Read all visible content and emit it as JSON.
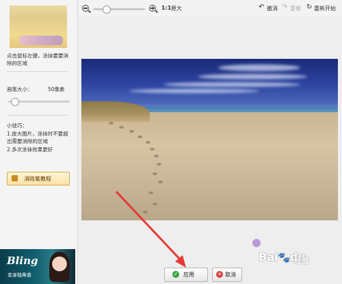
{
  "sidebar": {
    "instruction": "点击鼠标左键，涂抹要要消除的区域",
    "brush_size_label": "画笔大小：",
    "brush_size_value": "50像素",
    "brush_size_level": 0.1,
    "tips_title": "小技巧：",
    "tip_1": "1.放大图片，涂抹时不要超出需要消除的区域",
    "tip_2": "2.多次涂抹效果更好",
    "tutorial_button": "消除笔教程"
  },
  "ad": {
    "brand": "Bling",
    "caption": "变身独角兽"
  },
  "toolbar": {
    "zoom_level": 0.25,
    "original_size_label": "1:1",
    "original_size_text": "原大",
    "undo_label": "撤消",
    "redo_label": "重做",
    "restart_label": "重新开始"
  },
  "actions": {
    "apply_label": "应用",
    "cancel_label": "取消"
  },
  "watermark": {
    "brand": "Bai",
    "brand_end": "du",
    "suffix": "经验"
  },
  "colors": {
    "accent_red": "#e53935",
    "apply_green": "#3aa53a",
    "cancel_red": "#d84040"
  }
}
